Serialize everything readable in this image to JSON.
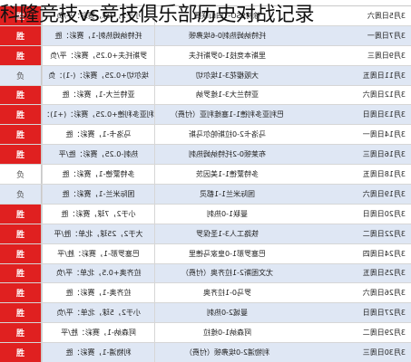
{
  "page": {
    "title": "科隆竞技vs竞技俱乐部历史对战记录"
  },
  "table": {
    "rows": [
      {
        "result": "胜",
        "detail": "小于2，7球，赛彩：平/负",
        "match": "徐特SSO-1四山联赛",
        "date": "3月5日周六",
        "style": "win"
      },
      {
        "result": "胜",
        "detail": "托特纳姆热刺-1，赛彩：胜",
        "match": "托特纳姆热刺0-6埃弗顿",
        "date": "3月7日周一",
        "style": "win"
      },
      {
        "result": "胜",
        "detail": "罗斯托夫+0.25，赛彩：平/负",
        "match": "里斯本竞技1-0罗斯托夫",
        "date": "3月9日周三",
        "style": "win"
      },
      {
        "result": "负",
        "detail": "埃尔切+0.25，赛彩：(-1)：负",
        "match": "大阪樱花3-1埃尔切",
        "date": "3月11日周五",
        "style": "lose"
      },
      {
        "result": "胜",
        "detail": "亚特兰大-1，赛彩：胜",
        "match": "亚特兰大3-1维罗纳",
        "date": "3月12日周六",
        "style": "win"
      },
      {
        "result": "胜",
        "detail": "巴利亚多利德+0.25，赛彩：(+1)：胜",
        "match": "巴利亚多利德1-1塞维利亚（付费）",
        "date": "3月13日周日",
        "style": "win"
      },
      {
        "result": "胜",
        "detail": "马洛卡-1，赛彩：胜",
        "match": "马洛卡2-0拉斯帕尔马斯",
        "date": "3月14日周一",
        "style": "win"
      },
      {
        "result": "胜",
        "detail": "热刺-0.25，赛彩：胜/平",
        "match": "布莱顿0-2托特纳姆热刺",
        "date": "3月16日周三",
        "style": "win"
      },
      {
        "result": "负",
        "detail": "多特蒙德-1，赛彩：胜",
        "match": "多特蒙德1-1美因茨",
        "date": "3月18日周五",
        "style": "lose"
      },
      {
        "result": "负",
        "detail": "国际米兰-1，赛彩：胜",
        "match": "国际米兰1-1都灵",
        "date": "3月19日周六",
        "style": "lose"
      },
      {
        "result": "胜",
        "detail": "小于2，7球，赛彩：胜",
        "match": "曼联1-0热刺",
        "date": "3月20日周日",
        "style": "win"
      },
      {
        "result": "胜",
        "detail": "大于2，25球，北单：胜/平",
        "match": "铁路工人3-1圣保罗",
        "date": "3月22日周二",
        "style": "win"
      },
      {
        "result": "胜",
        "detail": "巴塞罗那-1，赛彩：胜/平",
        "match": "巴塞罗那1-0皇家马德里",
        "date": "3月24日周四",
        "style": "win"
      },
      {
        "result": "胜",
        "detail": "拉齐奥+0.5，北单：平/负",
        "match": "尤文图斯2-1拉齐奥（付费）",
        "date": "3月25日周五",
        "style": "win"
      },
      {
        "result": "胜",
        "detail": "拉齐奥-1，赛彩：胜",
        "match": "罗马0-1拉齐奥",
        "date": "3月26日周六",
        "style": "win"
      },
      {
        "result": "胜",
        "detail": "小于2，5球，北单：平/负",
        "match": "曼城2-0热刺",
        "date": "3月27日周日",
        "style": "win"
      },
      {
        "result": "胜",
        "detail": "阿森纳-1，赛彩：胜/平",
        "match": "阿森纳1-0维拉",
        "date": "3月29日周二",
        "style": "win"
      },
      {
        "result": "胜",
        "detail": "利物浦-1，赛彩：胜",
        "match": "利物浦2-0埃弗顿（付费）",
        "date": "3月30日周三",
        "style": "win"
      }
    ]
  }
}
